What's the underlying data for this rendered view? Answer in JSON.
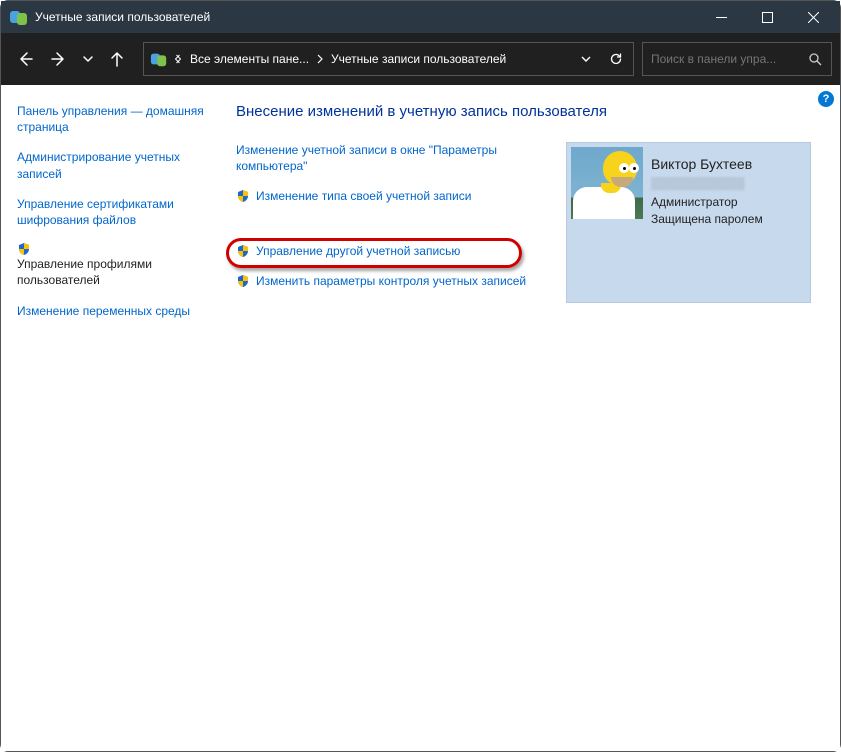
{
  "window": {
    "title": "Учетные записи пользователей"
  },
  "address": {
    "crumb1": "Все элементы пане...",
    "crumb2": "Учетные записи пользователей"
  },
  "search": {
    "placeholder": "Поиск в панели упра..."
  },
  "sidebar": {
    "items": [
      {
        "label": "Панель управления — домашняя страница",
        "shield": false,
        "active": false
      },
      {
        "label": "Администрирование учетных записей",
        "shield": false,
        "active": false
      },
      {
        "label": "Управление сертификатами шифрования файлов",
        "shield": false,
        "active": false
      },
      {
        "label": "Управление профилями пользователей",
        "shield": true,
        "active": true
      },
      {
        "label": "Изменение переменных среды",
        "shield": false,
        "active": false
      }
    ]
  },
  "main": {
    "heading": "Внесение изменений в учетную запись пользователя",
    "actions": [
      {
        "label": "Изменение учетной записи в окне \"Параметры компьютера\"",
        "shield": false
      },
      {
        "label": "Изменение типа своей учетной записи",
        "shield": true
      },
      {
        "label": "Управление другой учетной записью",
        "shield": true
      },
      {
        "label": "Изменить параметры контроля учетных записей",
        "shield": true
      }
    ]
  },
  "user": {
    "name": "Виктор Бухтеев",
    "email_masked": "████████████",
    "role": "Администратор",
    "protection": "Защищена паролем"
  },
  "help": {
    "tooltip": "?"
  }
}
